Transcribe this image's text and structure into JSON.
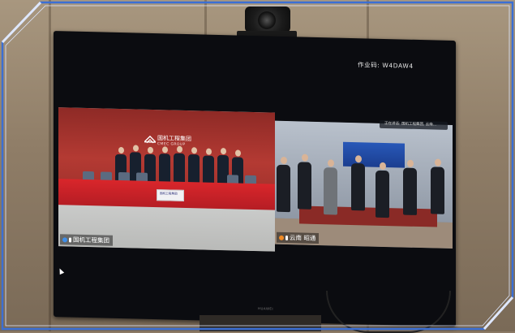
{
  "screen": {
    "meeting_code": "作业码: W4DAW4",
    "tv_brand": "HUAWEI"
  },
  "left_tile": {
    "logo_cn": "国机工程集团",
    "logo_en": "CMEC GROUP",
    "placard": "国机工程集团",
    "participant_label": "国机工程集团"
  },
  "right_tile": {
    "participant_label": "云南  昭通",
    "notice": "正在讲话: 国机工程集团, 云南..."
  },
  "colors": {
    "frame_blue": "#3b6fd4",
    "backdrop_red": "#b43a33",
    "table_red": "#d9262b"
  }
}
